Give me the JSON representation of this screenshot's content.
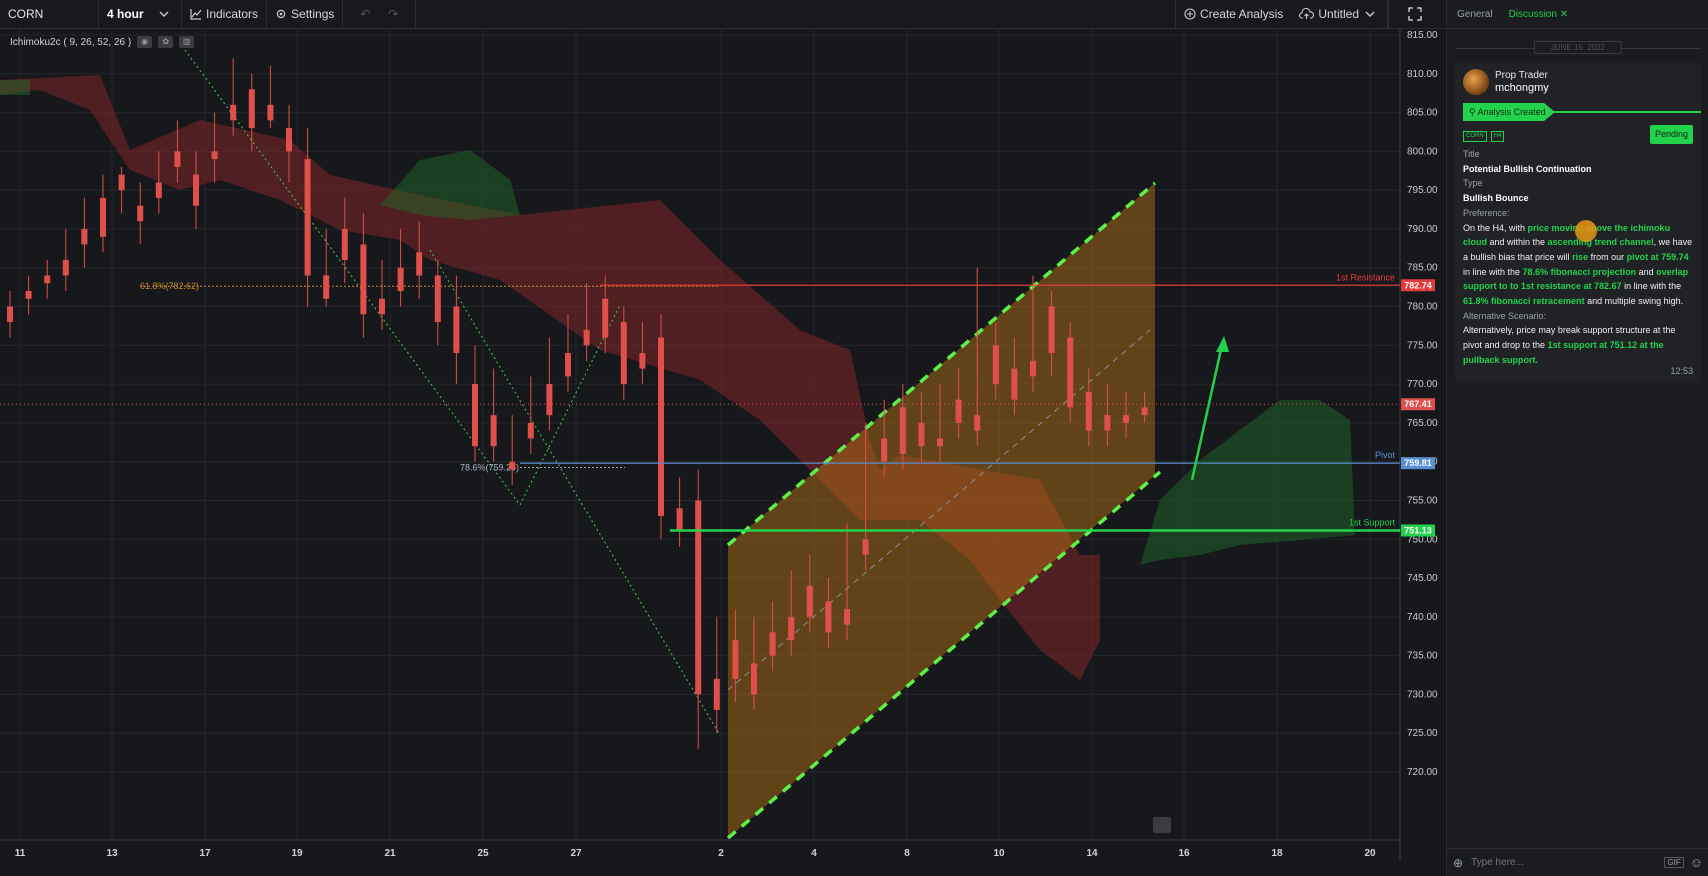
{
  "toolbar": {
    "symbol": "CORN",
    "interval": "4 hour",
    "indicators_label": "Indicators",
    "settings_label": "Settings",
    "create_analysis_label": "Create Analysis",
    "layout_name": "Untitled"
  },
  "indicator_legend": "Ichimoku2c ( 9, 26, 52, 26 )",
  "chart_data": {
    "type": "candlestick",
    "price_axis": {
      "ylim": [
        720,
        815
      ],
      "ticks": [
        "815.00",
        "810.00",
        "805.00",
        "800.00",
        "795.00",
        "790.00",
        "785.00",
        "780.00",
        "775.00",
        "770.00",
        "765.00",
        "760.00",
        "755.00",
        "750.00",
        "745.00",
        "740.00",
        "735.00",
        "730.00",
        "725.00",
        "720.00"
      ]
    },
    "time_axis": {
      "ticks": [
        "11",
        "13",
        "17",
        "19",
        "21",
        "25",
        "27",
        "2",
        "4",
        "8",
        "10",
        "14",
        "16",
        "18",
        "20"
      ]
    },
    "levels": [
      {
        "label": "1st Resistance",
        "price": "782.74",
        "color": "#e23b3b"
      },
      {
        "label": "Pivot",
        "price": "759.81",
        "color": "#5a8fd6"
      },
      {
        "label": "1st Support",
        "price": "751.13",
        "color": "#22d24c"
      }
    ],
    "current_price": "767.41",
    "fib_labels": [
      {
        "text": "61.8%(782.62)",
        "price": 782.62
      },
      {
        "text": "78.6%(759.25)",
        "price": 759.25
      }
    ],
    "candles": [
      [
        0,
        780,
        782,
        778,
        776
      ],
      [
        1,
        782,
        784,
        781,
        779
      ],
      [
        2,
        784,
        786,
        783,
        781
      ],
      [
        3,
        786,
        790,
        784,
        782
      ],
      [
        4,
        790,
        794,
        788,
        785
      ],
      [
        5,
        794,
        797,
        789,
        787
      ],
      [
        6,
        797,
        798,
        795,
        792
      ],
      [
        7,
        793,
        796,
        791,
        788
      ],
      [
        8,
        796,
        800,
        794,
        792
      ],
      [
        9,
        800,
        804,
        798,
        796
      ],
      [
        10,
        797,
        800,
        793,
        790
      ],
      [
        11,
        800,
        805,
        799,
        796
      ],
      [
        12,
        806,
        812,
        804,
        802
      ],
      [
        13,
        808,
        810,
        803,
        800
      ],
      [
        14,
        806,
        811,
        804,
        803
      ],
      [
        15,
        803,
        806,
        800,
        796
      ],
      [
        16,
        799,
        803,
        784,
        780
      ],
      [
        17,
        784,
        790,
        781,
        780
      ],
      [
        18,
        790,
        794,
        786,
        783
      ],
      [
        19,
        788,
        792,
        779,
        776
      ],
      [
        20,
        781,
        786,
        779,
        777
      ],
      [
        21,
        785,
        790,
        782,
        780
      ],
      [
        22,
        787,
        791,
        784,
        781
      ],
      [
        23,
        784,
        786,
        778,
        775
      ],
      [
        24,
        780,
        784,
        774,
        770
      ],
      [
        25,
        770,
        775,
        762,
        760
      ],
      [
        26,
        766,
        772,
        762,
        760
      ],
      [
        27,
        760,
        766,
        759,
        757
      ],
      [
        28,
        765,
        771,
        763,
        761
      ],
      [
        29,
        770,
        776,
        766,
        764
      ],
      [
        30,
        774,
        779,
        771,
        769
      ],
      [
        31,
        777,
        783,
        775,
        773
      ],
      [
        32,
        781,
        784,
        776,
        774
      ],
      [
        33,
        778,
        780,
        770,
        768
      ],
      [
        34,
        774,
        778,
        772,
        770
      ],
      [
        35,
        776,
        779,
        753,
        750
      ],
      [
        36,
        754,
        758,
        751,
        749
      ],
      [
        37,
        755,
        759,
        730,
        723
      ],
      [
        38,
        732,
        740,
        728,
        725
      ],
      [
        39,
        737,
        741,
        732,
        729
      ],
      [
        40,
        734,
        740,
        730,
        728
      ],
      [
        41,
        738,
        742,
        735,
        733
      ],
      [
        42,
        740,
        746,
        737,
        735
      ],
      [
        43,
        744,
        748,
        740,
        738
      ],
      [
        44,
        742,
        745,
        738,
        736
      ],
      [
        45,
        741,
        752,
        739,
        737
      ],
      [
        46,
        750,
        765,
        748,
        746
      ],
      [
        47,
        763,
        768,
        760,
        758
      ],
      [
        48,
        767,
        770,
        761,
        759
      ],
      [
        49,
        765,
        769,
        762,
        760
      ],
      [
        50,
        763,
        770,
        762,
        760
      ],
      [
        51,
        768,
        772,
        765,
        763
      ],
      [
        52,
        766,
        785,
        764,
        762
      ],
      [
        53,
        775,
        778,
        770,
        768
      ],
      [
        54,
        772,
        776,
        768,
        766
      ],
      [
        55,
        773,
        784,
        771,
        769
      ],
      [
        56,
        780,
        782,
        774,
        771
      ],
      [
        57,
        776,
        778,
        767,
        765
      ],
      [
        58,
        769,
        772,
        764,
        762
      ],
      [
        59,
        766,
        770,
        764,
        762
      ],
      [
        60,
        766,
        769,
        765,
        763
      ],
      [
        61,
        767,
        769,
        766,
        765
      ]
    ]
  },
  "panel": {
    "tabs": [
      "General",
      "Discussion"
    ],
    "active_tab": "Discussion",
    "date": "JUNE 15, 2022",
    "author_role": "Prop Trader",
    "author_name": "mchongmy",
    "status_flag": "Analysis Created",
    "tag_symbol": "CORN",
    "tag_interval": "H4",
    "status": "Pending",
    "title_label": "Title",
    "title_value": "Potential Bullish Continuation",
    "type_label": "Type",
    "type_value": "Bullish Bounce",
    "preference_label": "Preference:",
    "alt_label": "Alternative Scenario:",
    "time": "12:53",
    "input_placeholder": "Type here...",
    "gif_label": "GIF",
    "pref_parts": [
      {
        "t": "On the H4, with ",
        "g": false
      },
      {
        "t": "price moving above the ichimoku cloud",
        "g": true
      },
      {
        "t": " and within the ",
        "g": false
      },
      {
        "t": "ascending trend channel",
        "g": true
      },
      {
        "t": ", we have a bullish bias that price will ",
        "g": false
      },
      {
        "t": "rise",
        "g": true
      },
      {
        "t": " from our ",
        "g": false
      },
      {
        "t": "pivot at 759.74",
        "g": true
      },
      {
        "t": " in line with the ",
        "g": false
      },
      {
        "t": "78.6% fibonacci projection",
        "g": true
      },
      {
        "t": " and ",
        "g": false
      },
      {
        "t": "overlap support to to 1st resistance at 782.67",
        "g": true
      },
      {
        "t": " in line with the ",
        "g": false
      },
      {
        "t": "61.8% fibonacci retracement",
        "g": true
      },
      {
        "t": " and multiple swing high.",
        "g": false
      }
    ],
    "alt_parts": [
      {
        "t": "Alternatively, price may break support structure at the pivot and drop to the ",
        "g": false
      },
      {
        "t": "1st support at 751.12 at the pullback support.",
        "g": true
      }
    ]
  }
}
